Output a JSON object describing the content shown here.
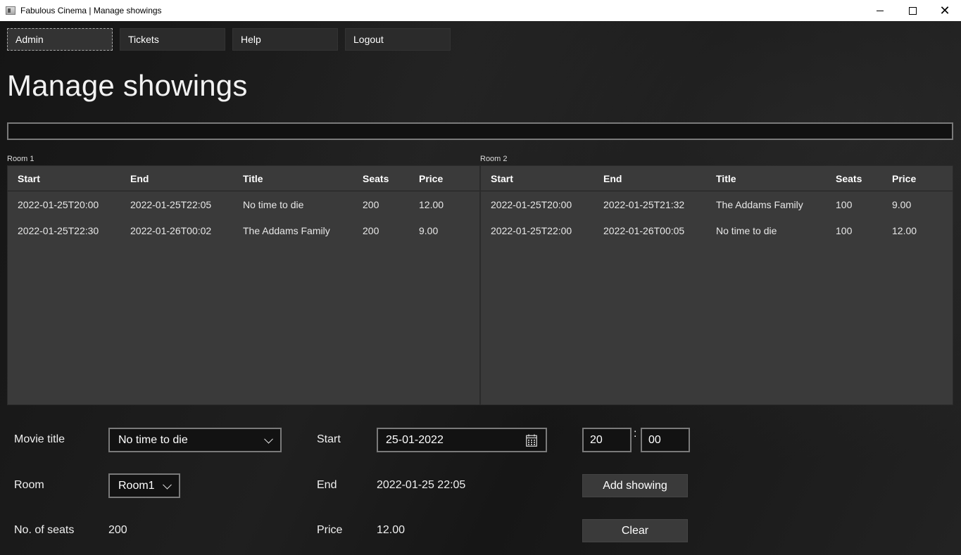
{
  "window": {
    "title": "Fabulous Cinema | Manage showings"
  },
  "menu": {
    "items": [
      {
        "label": "Admin"
      },
      {
        "label": "Tickets"
      },
      {
        "label": "Help"
      },
      {
        "label": "Logout"
      }
    ]
  },
  "page": {
    "title": "Manage showings"
  },
  "columns": [
    "Start",
    "End",
    "Title",
    "Seats",
    "Price"
  ],
  "rooms": [
    {
      "label": "Room 1",
      "rows": [
        [
          "2022-01-25T20:00",
          "2022-01-25T22:05",
          "No time to die",
          "200",
          "12.00"
        ],
        [
          "2022-01-25T22:30",
          "2022-01-26T00:02",
          "The Addams Family",
          "200",
          "9.00"
        ]
      ]
    },
    {
      "label": "Room 2",
      "rows": [
        [
          "2022-01-25T20:00",
          "2022-01-25T21:32",
          "The Addams Family",
          "100",
          "9.00"
        ],
        [
          "2022-01-25T22:00",
          "2022-01-26T00:05",
          "No time to die",
          "100",
          "12.00"
        ]
      ]
    }
  ],
  "form": {
    "movie_title_label": "Movie title",
    "movie_title_value": "No time to die",
    "room_label": "Room",
    "room_value": "Room1",
    "seats_label": "No. of seats",
    "seats_value": "200",
    "start_label": "Start",
    "start_date": "25-01-2022",
    "start_hour": "20",
    "time_separator": ":",
    "start_minute": "00",
    "end_label": "End",
    "end_value": "2022-01-25 22:05",
    "price_label": "Price",
    "price_value": "12.00",
    "add_button": "Add showing",
    "clear_button": "Clear"
  }
}
